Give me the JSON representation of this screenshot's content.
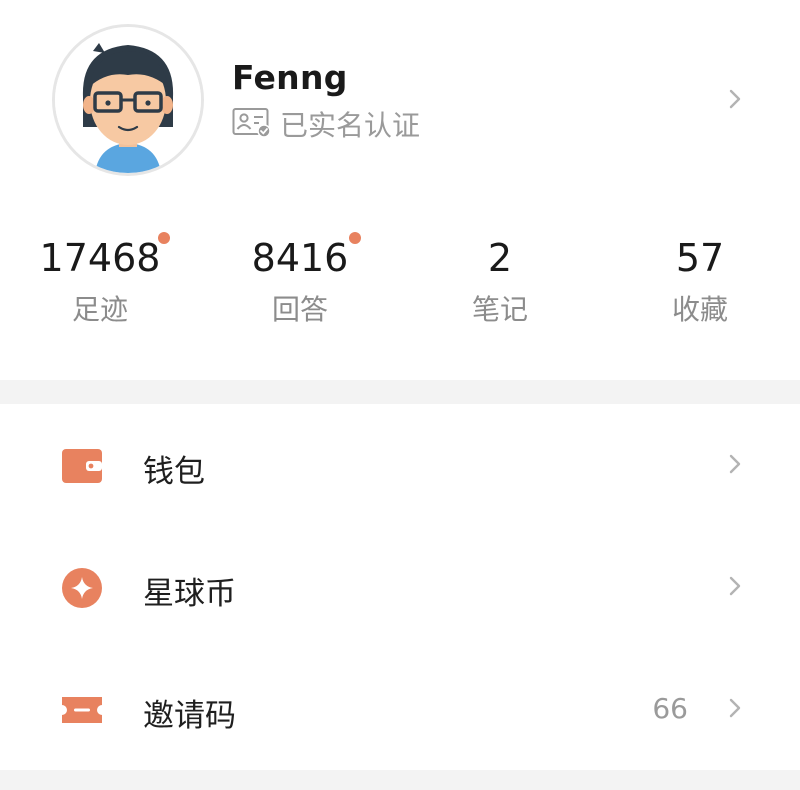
{
  "profile": {
    "username": "Fenng",
    "verify_text": "已实名认证"
  },
  "stats": [
    {
      "value": "17468",
      "label": "足迹",
      "has_dot": true
    },
    {
      "value": "8416",
      "label": "回答",
      "has_dot": true
    },
    {
      "value": "2",
      "label": "笔记",
      "has_dot": false
    },
    {
      "value": "57",
      "label": "收藏",
      "has_dot": false
    }
  ],
  "menu": [
    {
      "label": "钱包",
      "icon": "wallet-icon",
      "value": ""
    },
    {
      "label": "星球币",
      "icon": "star-coin-icon",
      "value": ""
    },
    {
      "label": "邀请码",
      "icon": "ticket-icon",
      "value": "66"
    }
  ],
  "colors": {
    "accent": "#e8825f",
    "muted_text": "#9a9a9a",
    "divider": "#f3f3f3"
  }
}
